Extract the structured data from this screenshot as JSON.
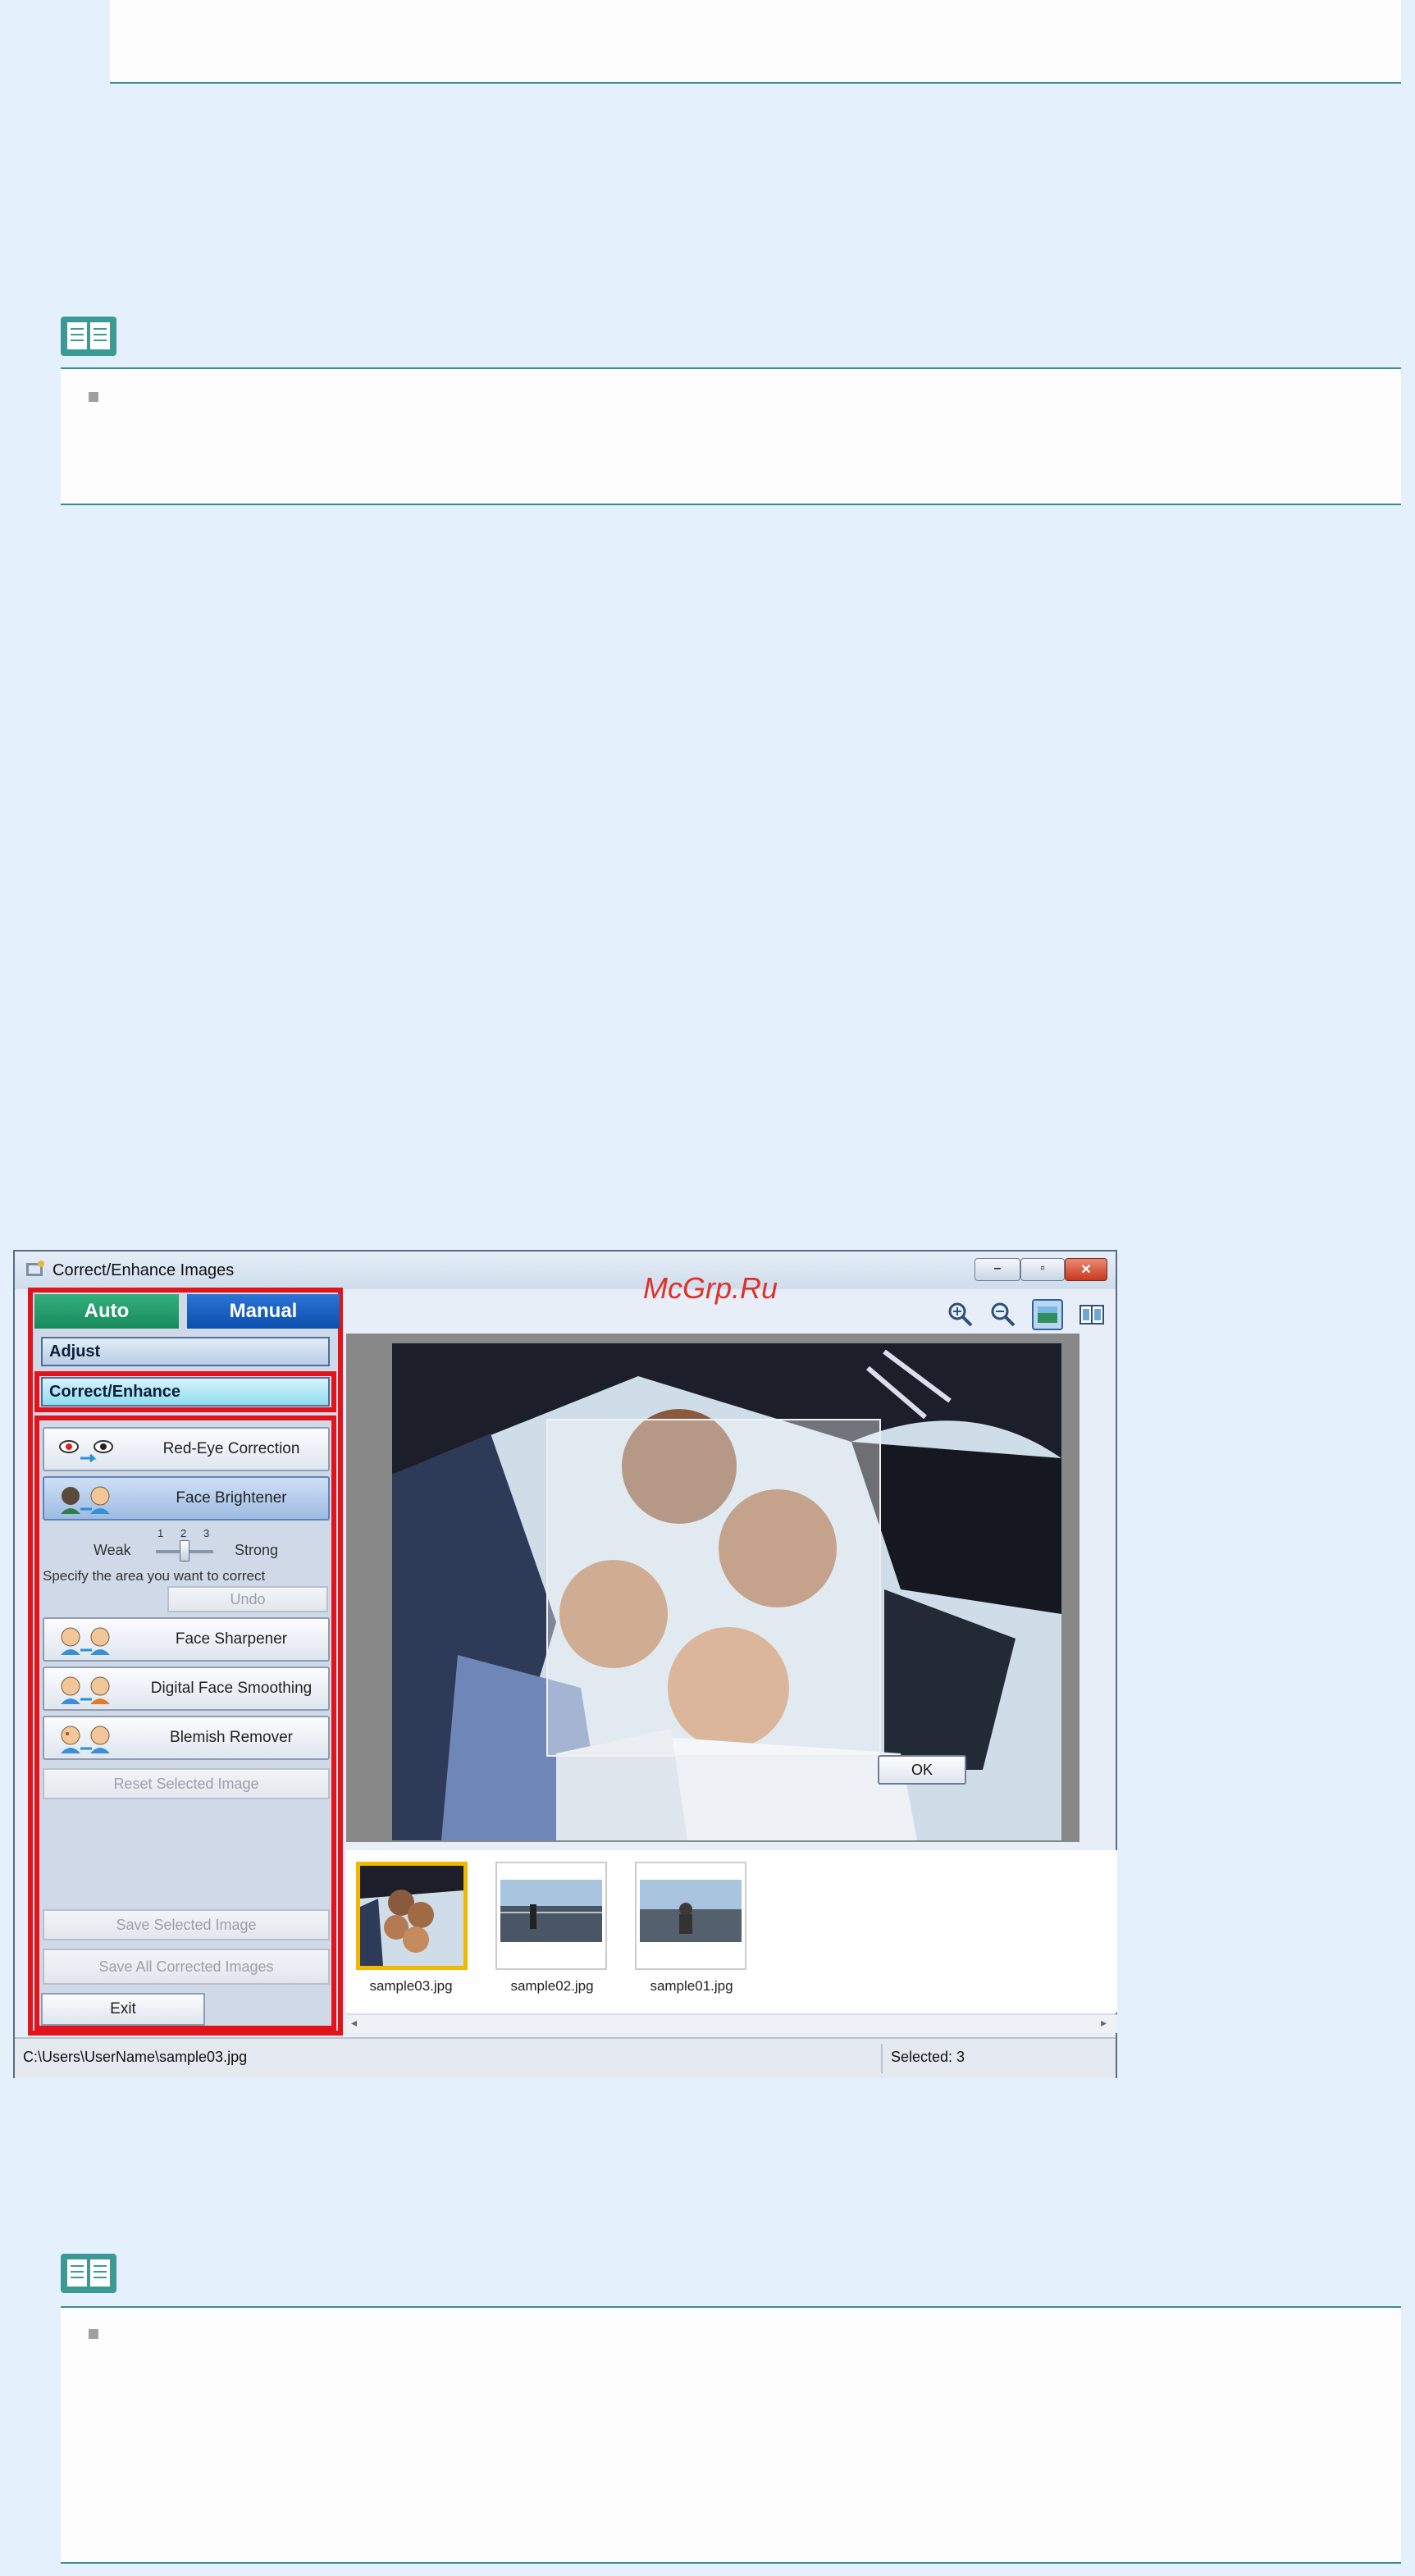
{
  "window": {
    "title": "Correct/Enhance Images",
    "watermark": "McGrp.Ru"
  },
  "tabs": {
    "auto": "Auto",
    "manual": "Manual"
  },
  "sections": {
    "adjust": "Adjust",
    "correct_enhance": "Correct/Enhance"
  },
  "tools": {
    "red_eye": "Red-Eye Correction",
    "face_brightener": "Face Brightener",
    "face_sharpener": "Face Sharpener",
    "digital_face_smoothing": "Digital Face Smoothing",
    "blemish_remover": "Blemish Remover"
  },
  "slider": {
    "weak": "Weak",
    "strong": "Strong",
    "ticks": [
      "1",
      "2",
      "3"
    ],
    "level": 2
  },
  "instruction": "Specify the area you want to correct",
  "buttons": {
    "undo": "Undo",
    "reset_selected": "Reset Selected Image",
    "save_selected": "Save Selected Image",
    "save_all": "Save All Corrected Images",
    "exit": "Exit",
    "ok": "OK"
  },
  "thumbnails": [
    {
      "label": "sample03.jpg",
      "selected": true
    },
    {
      "label": "sample02.jpg",
      "selected": false
    },
    {
      "label": "sample01.jpg",
      "selected": false
    }
  ],
  "status": {
    "path": "C:\\Users\\UserName\\sample03.jpg",
    "selected": "Selected: 3"
  },
  "icons": [
    "zoom-in-icon",
    "zoom-out-icon",
    "whole-image-icon",
    "compare-icon"
  ],
  "colors": {
    "highlight_red": "#e1141c",
    "auto_tab": "#1f9a69",
    "manual_tab": "#1558c0",
    "page_bg": "#e4f0fc"
  }
}
